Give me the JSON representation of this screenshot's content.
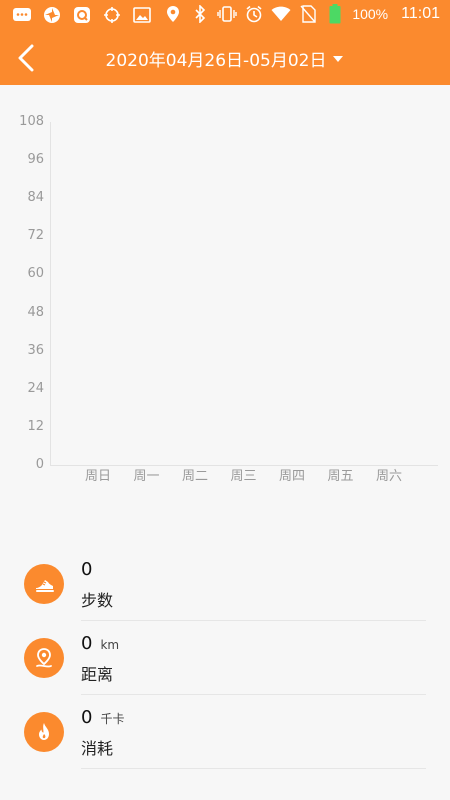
{
  "status_bar": {
    "battery_percent": "100%",
    "time": "11:01"
  },
  "header": {
    "date_range": "2020年04月26日-05月02日",
    "accent_color": "#fb8a2e"
  },
  "chart_data": {
    "type": "bar",
    "categories": [
      "周日",
      "周一",
      "周二",
      "周三",
      "周四",
      "周五",
      "周六"
    ],
    "values": [
      0,
      0,
      0,
      0,
      0,
      0,
      0
    ],
    "y_ticks": [
      "108",
      "96",
      "84",
      "72",
      "60",
      "48",
      "36",
      "24",
      "12",
      "0"
    ],
    "ylim": [
      0,
      108
    ],
    "title": "",
    "xlabel": "",
    "ylabel": "",
    "grid": false
  },
  "stats": [
    {
      "value": "0",
      "unit": "",
      "label": "步数",
      "icon": "running-shoe-icon"
    },
    {
      "value": "0",
      "unit": "km",
      "label": "距离",
      "icon": "location-pin-icon"
    },
    {
      "value": "0",
      "unit": "千卡",
      "label": "消耗",
      "icon": "flame-icon"
    }
  ]
}
